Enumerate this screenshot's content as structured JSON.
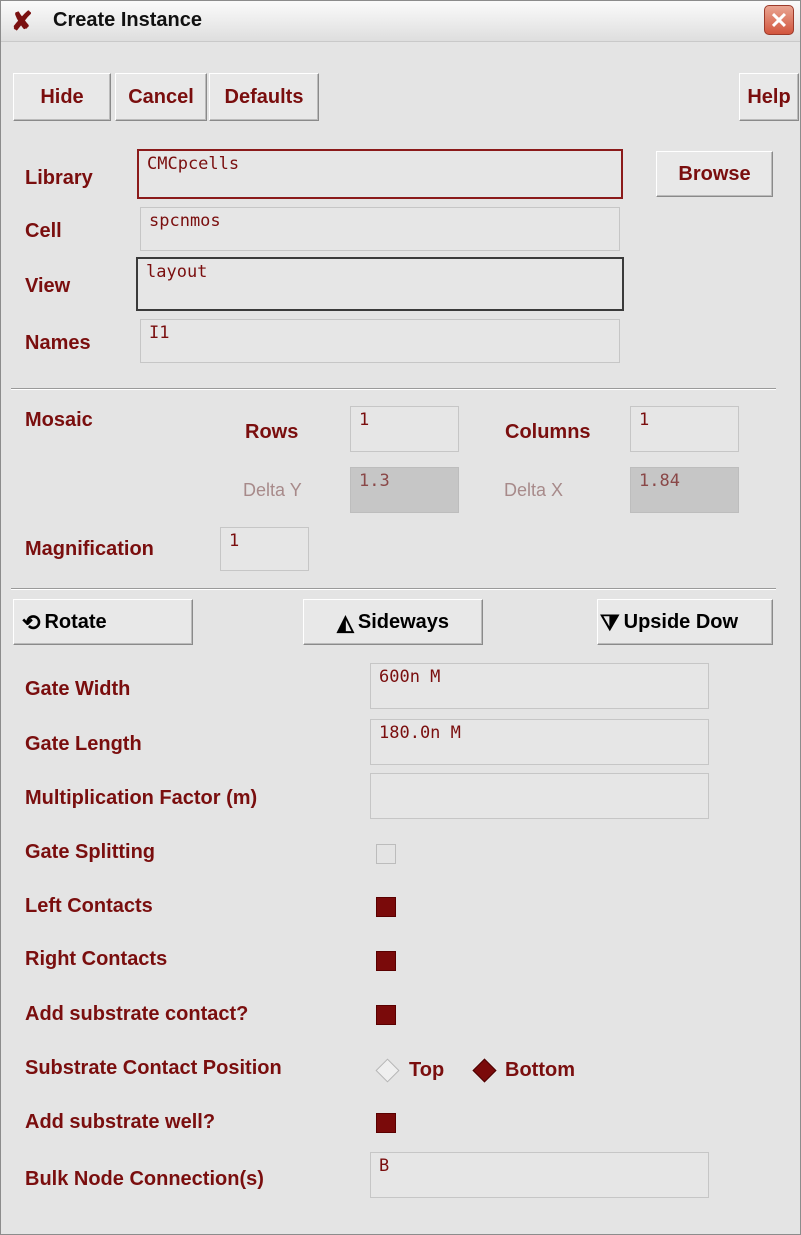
{
  "window": {
    "title": "Create Instance"
  },
  "toolbar": {
    "hide": "Hide",
    "cancel": "Cancel",
    "defaults": "Defaults",
    "help": "Help"
  },
  "identity": {
    "library": {
      "label": "Library",
      "value": "CMCpcells"
    },
    "browse": "Browse",
    "cell": {
      "label": "Cell",
      "value": "spcnmos"
    },
    "view": {
      "label": "View",
      "value": "layout"
    },
    "names": {
      "label": "Names",
      "value": "I1"
    }
  },
  "mosaic": {
    "label": "Mosaic",
    "rows": {
      "label": "Rows",
      "value": "1"
    },
    "columns": {
      "label": "Columns",
      "value": "1"
    },
    "delta_y": {
      "label": "Delta Y",
      "value": "1.3"
    },
    "delta_x": {
      "label": "Delta X",
      "value": "1.84"
    },
    "magnification": {
      "label": "Magnification",
      "value": "1"
    }
  },
  "transform": {
    "rotate": "Rotate",
    "sideways": "Sideways",
    "upside_down": "Upside Dow"
  },
  "params": {
    "gate_width": {
      "label": "Gate Width",
      "value": "600n M"
    },
    "gate_length": {
      "label": "Gate Length",
      "value": "180.0n M"
    },
    "mult_factor": {
      "label": "Multiplication Factor (m)",
      "value": ""
    },
    "gate_splitting": {
      "label": "Gate Splitting",
      "checked": false
    },
    "left_contacts": {
      "label": "Left Contacts",
      "checked": true
    },
    "right_contacts": {
      "label": "Right Contacts",
      "checked": true
    },
    "add_sub_contact": {
      "label": "Add substrate contact?",
      "checked": true
    },
    "sub_contact_position": {
      "label": "Substrate Contact Position",
      "options": [
        "Top",
        "Bottom"
      ],
      "selected": "Bottom"
    },
    "add_sub_well": {
      "label": "Add substrate well?",
      "checked": true
    },
    "bulk_node": {
      "label": "Bulk Node Connection(s)",
      "value": "B"
    }
  },
  "colors": {
    "label": "#7a0e0e",
    "checked_fill": "#7a0a0a",
    "window_bg": "#e4e4e4"
  }
}
